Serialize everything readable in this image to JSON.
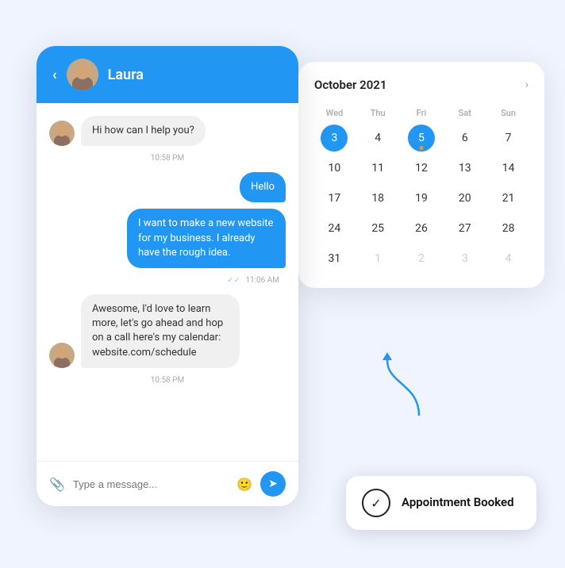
{
  "scene": {
    "background": "#f0f4ff"
  },
  "chat": {
    "header": {
      "back_label": "‹",
      "user_name": "Laura"
    },
    "messages": [
      {
        "type": "incoming",
        "text": "Hi how can I help you?",
        "time": "10:58 PM",
        "show_avatar": true
      },
      {
        "type": "outgoing",
        "text": "Hello",
        "time": null,
        "show_avatar": false
      },
      {
        "type": "outgoing",
        "text": "I want to make a new website for my business. I already have the rough idea.",
        "time": "11:06 AM",
        "show_avatar": false,
        "double_check": true
      },
      {
        "type": "incoming",
        "text": "Awesome, I'd love to learn more, let's go ahead and hop on a call here's my calendar: website.com/schedule",
        "time": "10:58 PM",
        "show_avatar": true
      }
    ],
    "footer": {
      "placeholder": "Type a message..."
    }
  },
  "calendar": {
    "title": "October 2021",
    "nav_next": "›",
    "day_headers": [
      "Wed",
      "Thu",
      "Fri",
      "Sat",
      "Sun"
    ],
    "weeks": [
      [
        {
          "day": "3",
          "highlight": true,
          "dot": false,
          "gray": false
        },
        {
          "day": "4",
          "highlight": false,
          "dot": false,
          "gray": false
        },
        {
          "day": "5",
          "highlight": true,
          "dot": true,
          "gray": false
        },
        {
          "day": "6",
          "highlight": false,
          "dot": false,
          "gray": false
        },
        {
          "day": "7",
          "highlight": false,
          "dot": false,
          "gray": false
        }
      ],
      [
        {
          "day": "10",
          "highlight": false,
          "dot": false,
          "gray": false
        },
        {
          "day": "11",
          "highlight": false,
          "dot": false,
          "gray": false
        },
        {
          "day": "12",
          "highlight": false,
          "dot": false,
          "gray": false
        },
        {
          "day": "13",
          "highlight": false,
          "dot": false,
          "gray": false
        },
        {
          "day": "14",
          "highlight": false,
          "dot": false,
          "gray": false
        }
      ],
      [
        {
          "day": "17",
          "highlight": false,
          "dot": false,
          "gray": false
        },
        {
          "day": "18",
          "highlight": false,
          "dot": false,
          "gray": false
        },
        {
          "day": "19",
          "highlight": false,
          "dot": false,
          "gray": false
        },
        {
          "day": "20",
          "highlight": false,
          "dot": false,
          "gray": false
        },
        {
          "day": "21",
          "highlight": false,
          "dot": false,
          "gray": false
        }
      ],
      [
        {
          "day": "24",
          "highlight": false,
          "dot": false,
          "gray": false
        },
        {
          "day": "25",
          "highlight": false,
          "dot": false,
          "gray": false
        },
        {
          "day": "26",
          "highlight": false,
          "dot": false,
          "gray": false
        },
        {
          "day": "27",
          "highlight": false,
          "dot": false,
          "gray": false
        },
        {
          "day": "28",
          "highlight": false,
          "dot": false,
          "gray": false
        }
      ],
      [
        {
          "day": "31",
          "highlight": false,
          "dot": false,
          "gray": false
        },
        {
          "day": "1",
          "highlight": false,
          "dot": false,
          "gray": true
        },
        {
          "day": "2",
          "highlight": false,
          "dot": false,
          "gray": true
        },
        {
          "day": "3",
          "highlight": false,
          "dot": false,
          "gray": true
        },
        {
          "day": "4",
          "highlight": false,
          "dot": false,
          "gray": true
        }
      ]
    ]
  },
  "appointment": {
    "text": "Appointment Booked",
    "check_icon": "✓"
  }
}
